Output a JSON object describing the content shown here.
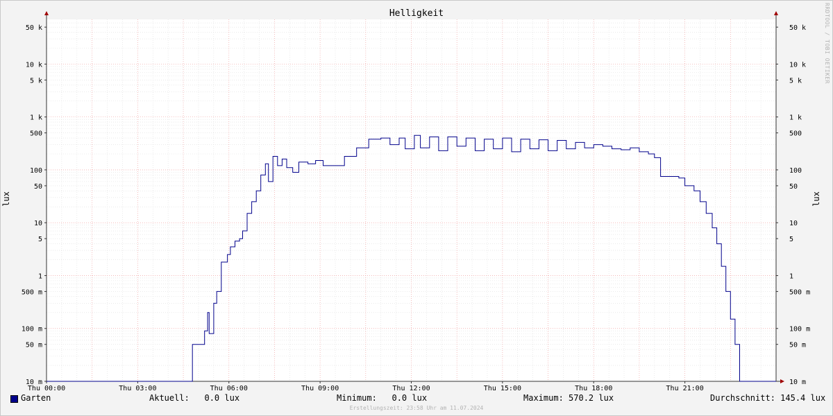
{
  "chart_data": {
    "type": "line",
    "title": "Helligkeit",
    "ylabel": "lux",
    "y_scale": "log",
    "ylim": [
      0.01,
      70000
    ],
    "y_ticks": [
      {
        "value": 50000,
        "label": "50 k"
      },
      {
        "value": 10000,
        "label": "10 k"
      },
      {
        "value": 5000,
        "label": "5 k"
      },
      {
        "value": 1000,
        "label": "1 k"
      },
      {
        "value": 500,
        "label": "500"
      },
      {
        "value": 100,
        "label": "100"
      },
      {
        "value": 50,
        "label": "50"
      },
      {
        "value": 10,
        "label": "10"
      },
      {
        "value": 5,
        "label": "5"
      },
      {
        "value": 1,
        "label": "1"
      },
      {
        "value": 0.5,
        "label": "500 m"
      },
      {
        "value": 0.1,
        "label": "100 m"
      },
      {
        "value": 0.05,
        "label": "50 m"
      },
      {
        "value": 0.01,
        "label": "10 m"
      }
    ],
    "x_unit": "hour of day",
    "xlim": [
      0,
      24
    ],
    "x_ticks": [
      {
        "value": 0,
        "label": "Thu 00:00"
      },
      {
        "value": 3,
        "label": "Thu 03:00"
      },
      {
        "value": 6,
        "label": "Thu 06:00"
      },
      {
        "value": 9,
        "label": "Thu 09:00"
      },
      {
        "value": 12,
        "label": "Thu 12:00"
      },
      {
        "value": 15,
        "label": "Thu 15:00"
      },
      {
        "value": 18,
        "label": "Thu 18:00"
      },
      {
        "value": 21,
        "label": "Thu 21:00"
      }
    ],
    "grid": true,
    "color": "#00008b",
    "series": [
      {
        "name": "Garten",
        "points": [
          [
            0,
            0.01
          ],
          [
            4.8,
            0.01
          ],
          [
            4.8,
            0.05
          ],
          [
            5.05,
            0.05
          ],
          [
            5.2,
            0.09
          ],
          [
            5.3,
            0.2
          ],
          [
            5.35,
            0.08
          ],
          [
            5.45,
            0.08
          ],
          [
            5.5,
            0.3
          ],
          [
            5.6,
            0.5
          ],
          [
            5.75,
            1.8
          ],
          [
            5.95,
            2.5
          ],
          [
            6.05,
            3.5
          ],
          [
            6.2,
            4.5
          ],
          [
            6.35,
            5
          ],
          [
            6.45,
            7
          ],
          [
            6.6,
            15
          ],
          [
            6.75,
            25
          ],
          [
            6.9,
            40
          ],
          [
            7.05,
            80
          ],
          [
            7.2,
            130
          ],
          [
            7.3,
            60
          ],
          [
            7.45,
            180
          ],
          [
            7.6,
            120
          ],
          [
            7.75,
            160
          ],
          [
            7.9,
            110
          ],
          [
            8.1,
            90
          ],
          [
            8.3,
            140
          ],
          [
            8.6,
            130
          ],
          [
            8.85,
            150
          ],
          [
            9.1,
            120
          ],
          [
            9.4,
            120
          ],
          [
            9.8,
            180
          ],
          [
            10.2,
            260
          ],
          [
            10.6,
            380
          ],
          [
            11.0,
            400
          ],
          [
            11.3,
            300
          ],
          [
            11.6,
            400
          ],
          [
            11.8,
            250
          ],
          [
            12.1,
            450
          ],
          [
            12.3,
            260
          ],
          [
            12.6,
            420
          ],
          [
            12.9,
            230
          ],
          [
            13.2,
            420
          ],
          [
            13.5,
            280
          ],
          [
            13.8,
            400
          ],
          [
            14.1,
            230
          ],
          [
            14.4,
            380
          ],
          [
            14.7,
            250
          ],
          [
            15.0,
            400
          ],
          [
            15.3,
            220
          ],
          [
            15.6,
            380
          ],
          [
            15.9,
            250
          ],
          [
            16.2,
            370
          ],
          [
            16.5,
            230
          ],
          [
            16.8,
            360
          ],
          [
            17.1,
            250
          ],
          [
            17.4,
            330
          ],
          [
            17.7,
            260
          ],
          [
            18.0,
            300
          ],
          [
            18.3,
            280
          ],
          [
            18.6,
            250
          ],
          [
            18.9,
            240
          ],
          [
            19.2,
            260
          ],
          [
            19.5,
            220
          ],
          [
            19.8,
            200
          ],
          [
            20.0,
            170
          ],
          [
            20.2,
            75
          ],
          [
            20.5,
            75
          ],
          [
            20.8,
            70
          ],
          [
            21.0,
            50
          ],
          [
            21.3,
            40
          ],
          [
            21.5,
            25
          ],
          [
            21.7,
            15
          ],
          [
            21.9,
            8
          ],
          [
            22.05,
            4
          ],
          [
            22.2,
            1.5
          ],
          [
            22.35,
            0.5
          ],
          [
            22.5,
            0.15
          ],
          [
            22.65,
            0.05
          ],
          [
            22.8,
            0.05
          ],
          [
            22.8,
            0.01
          ],
          [
            24,
            0.01
          ]
        ]
      }
    ]
  },
  "legend": {
    "series_name": "Garten",
    "aktuell": "Aktuell:   0.0 lux",
    "minimum": "Minimum:   0.0 lux",
    "maximum": "Maximum: 570.2 lux",
    "durchschnitt": "Durchschnitt: 145.4 lux"
  },
  "footer": "Erstellungszeit: 23:58 Uhr am 11.07.2024",
  "watermark": "RRDTOOL / TOBI OETIKER"
}
